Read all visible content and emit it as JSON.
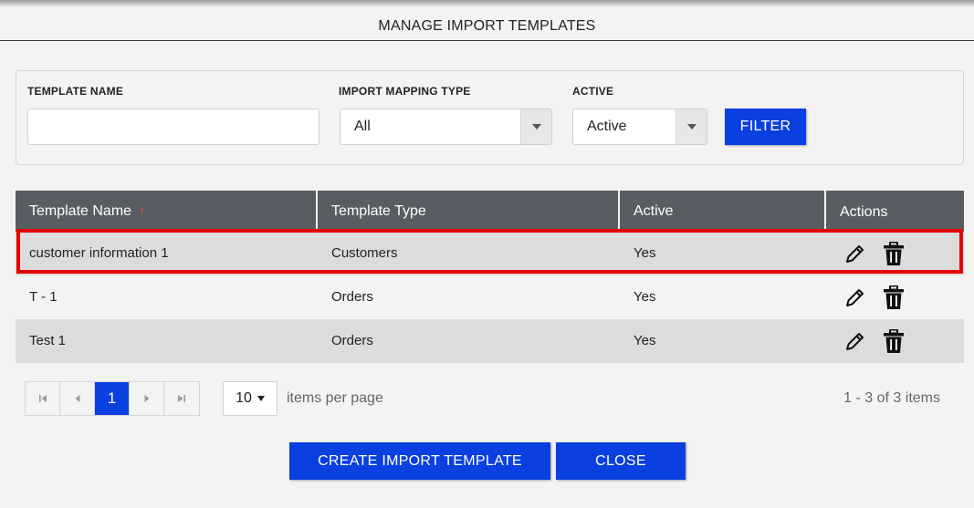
{
  "dialog": {
    "title": "MANAGE IMPORT TEMPLATES"
  },
  "filters": {
    "template_name_label": "TEMPLATE NAME",
    "template_name_value": "",
    "mapping_type_label": "IMPORT MAPPING TYPE",
    "mapping_type_value": "All",
    "active_label": "ACTIVE",
    "active_value": "Active",
    "filter_button": "FILTER"
  },
  "grid": {
    "columns": [
      "Template Name",
      "Template Type",
      "Active",
      "Actions"
    ],
    "sort_indicator": "↑",
    "rows": [
      {
        "name": "customer information 1",
        "type": "Customers",
        "active": "Yes"
      },
      {
        "name": "T - 1",
        "type": "Orders",
        "active": "Yes"
      },
      {
        "name": "Test 1",
        "type": "Orders",
        "active": "Yes"
      }
    ],
    "highlighted_row_index": 0
  },
  "pager": {
    "current_page": "1",
    "page_size": "10",
    "items_per_page_label": "items per page",
    "summary": "1 - 3 of 3 items"
  },
  "footer": {
    "create_button": "CREATE IMPORT TEMPLATE",
    "close_button": "CLOSE"
  },
  "colors": {
    "accent": "#0a3fe0",
    "header_bg": "#585d63",
    "highlight_border": "#e60000",
    "sort_arrow": "#ff4d4d"
  },
  "icons": {
    "edit": "pencil-icon",
    "delete": "trash-icon",
    "first": "first-page-icon",
    "prev": "prev-page-icon",
    "next": "next-page-icon",
    "last": "last-page-icon"
  }
}
